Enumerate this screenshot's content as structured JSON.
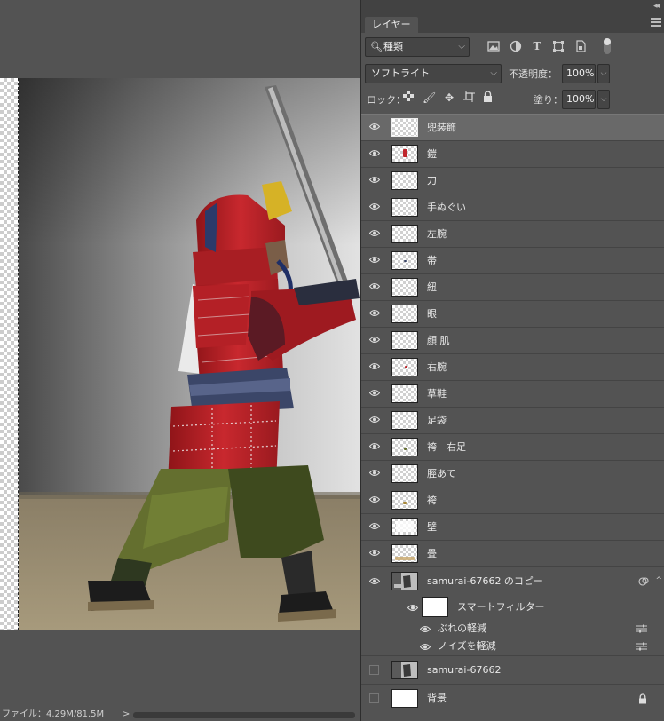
{
  "status_bar": {
    "file_info": "ファイル：4.29M/81.5M",
    "arrow": ">"
  },
  "panel": {
    "tab_label": "レイヤー",
    "filter_kind": "種類",
    "filter_icons": [
      "image-filter-icon",
      "adjustment-filter-icon",
      "type-filter-icon",
      "shape-filter-icon",
      "smart-object-filter-icon"
    ],
    "blend_mode": "ソフトライト",
    "opacity_label": "不透明度：",
    "opacity_value": "100%",
    "lock_label": "ロック：",
    "fill_label": "塗り：",
    "fill_value": "100%"
  },
  "layers": [
    {
      "name": "兜装飾",
      "selected": true
    },
    {
      "name": "鎧"
    },
    {
      "name": "刀"
    },
    {
      "name": "手ぬぐい"
    },
    {
      "name": "左腕"
    },
    {
      "name": "帯"
    },
    {
      "name": "紐"
    },
    {
      "name": "眼"
    },
    {
      "name": "顔 肌"
    },
    {
      "name": "右腕"
    },
    {
      "name": "草鞋"
    },
    {
      "name": "足袋"
    },
    {
      "name": "袴　右足"
    },
    {
      "name": "脛あて"
    },
    {
      "name": "袴"
    },
    {
      "name": "壁"
    },
    {
      "name": "畳"
    }
  ],
  "smart_layer": {
    "name": "samurai-67662 のコピー",
    "smart_filters_label": "スマートフィルター",
    "filters": [
      "ぶれの軽減",
      "ノイズを軽減"
    ]
  },
  "hidden_layers": [
    {
      "name": "samurai-67662"
    },
    {
      "name": "背景",
      "locked": true
    }
  ],
  "colors": {
    "panel_bg": "#535353",
    "selected_row": "#696969",
    "armor_red": "#b8242a"
  }
}
